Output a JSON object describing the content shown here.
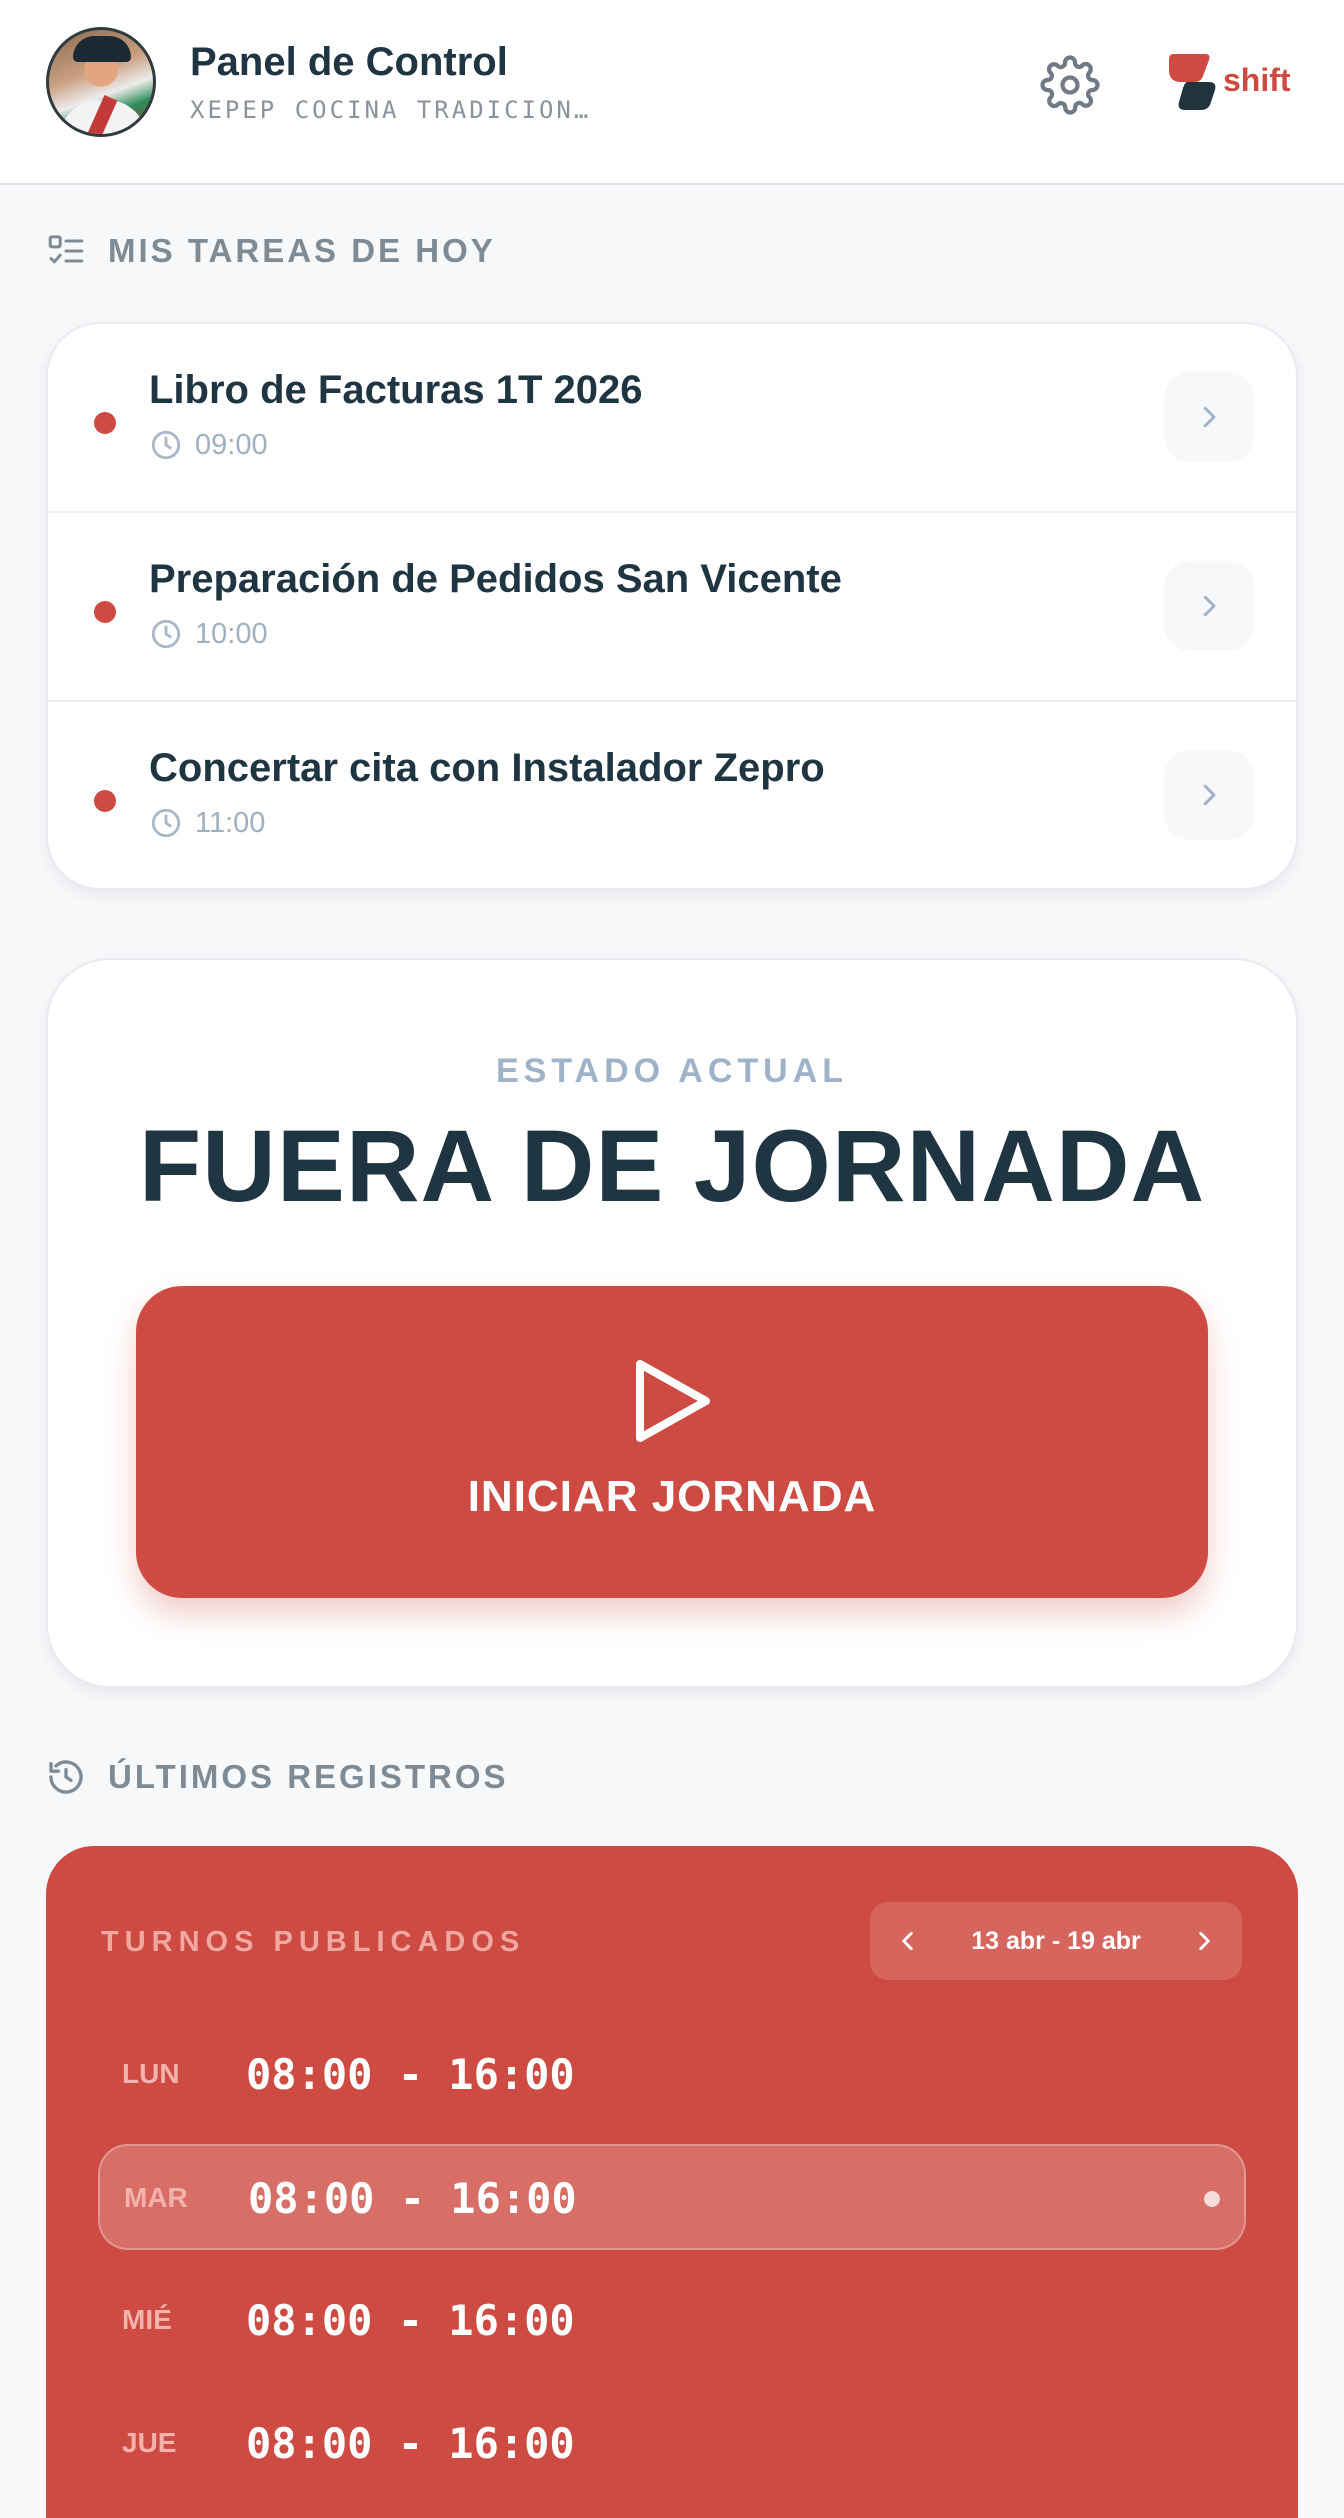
{
  "header": {
    "title": "Panel de Control",
    "company": "XEPEP COCINA TRADICION…",
    "settings_icon": "gear-icon",
    "logo_text": "shift",
    "brand_color": "#cd4b42"
  },
  "tasks": {
    "section_label": "MIS TAREAS DE HOY",
    "section_icon": "task-list-icon",
    "items": [
      {
        "title": "Libro de Facturas 1T 2026",
        "time": "09:00"
      },
      {
        "title": "Preparación de Pedidos San Vicente",
        "time": "10:00"
      },
      {
        "title": "Concertar cita con Instalador Zepro",
        "time": "11:00"
      }
    ]
  },
  "status": {
    "label": "ESTADO ACTUAL",
    "value": "FUERA DE JORNADA",
    "button_label": "INICIAR JORNADA",
    "button_icon": "play-icon"
  },
  "records": {
    "section_label": "ÚLTIMOS REGISTROS",
    "section_icon": "history-icon"
  },
  "shifts": {
    "title": "TURNOS PUBLICADOS",
    "range": "13 abr - 19 abr",
    "days": [
      {
        "day": "LUN",
        "hours": "08:00 - 16:00",
        "current": false
      },
      {
        "day": "MAR",
        "hours": "08:00 - 16:00",
        "current": true
      },
      {
        "day": "MIÉ",
        "hours": "08:00 - 16:00",
        "current": false
      },
      {
        "day": "JUE",
        "hours": "08:00 - 16:00",
        "current": false
      }
    ]
  }
}
